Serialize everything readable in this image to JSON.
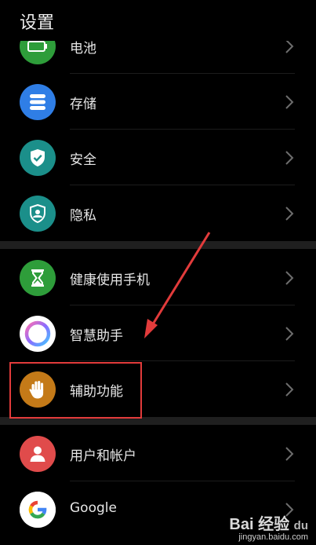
{
  "header": {
    "title": "设置"
  },
  "settings_items": [
    {
      "label": "电池",
      "icon": "battery-icon",
      "color": "#2e9d3a"
    },
    {
      "label": "存储",
      "icon": "storage-icon",
      "color": "#2f7ee6"
    },
    {
      "label": "安全",
      "icon": "shield-check-icon",
      "color": "#1b8f8a"
    },
    {
      "label": "隐私",
      "icon": "privacy-shield-icon",
      "color": "#1b8f8a"
    },
    {
      "label": "健康使用手机",
      "icon": "hourglass-icon",
      "color": "#2e9d3a"
    },
    {
      "label": "智慧助手",
      "icon": "assistant-ring-icon",
      "color": "#ffffff"
    },
    {
      "label": "辅助功能",
      "icon": "hand-icon",
      "color": "#c47a18"
    },
    {
      "label": "用户和帐户",
      "icon": "user-icon",
      "color": "#e04b4b"
    },
    {
      "label": "Google",
      "icon": "google-icon",
      "color": "#ffffff"
    }
  ],
  "annotation": {
    "color": "#e23b3b"
  },
  "watermark": {
    "brand": "Bai  经验",
    "paw": "du",
    "url": "jingyan.baidu.com"
  }
}
